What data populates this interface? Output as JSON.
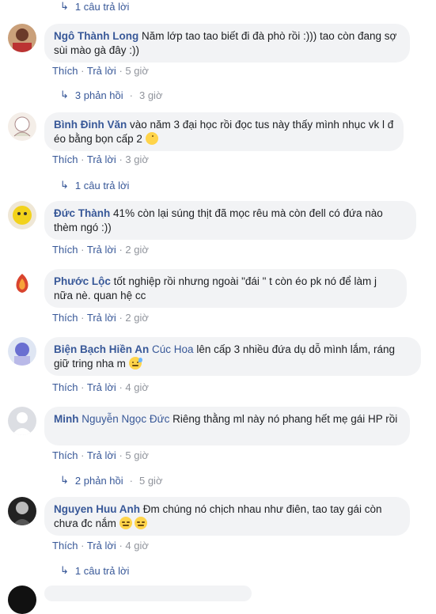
{
  "action_like": "Thích",
  "action_reply": "Trả lời",
  "sep": "·",
  "top_reply": {
    "text": "1 câu trả lời"
  },
  "comments": [
    {
      "name": "Ngô Thành Long",
      "tag": "",
      "text": "Năm lớp tao tao biết đi đà phò rồi :))) tao còn đang sợ sùi mào gà đây :))",
      "time": "5 giờ",
      "replies": "3 phản hồi",
      "replies_time": "3 giờ"
    },
    {
      "name": "Bình Đinh Văn",
      "tag": "",
      "text": "vào năm 3 đại học rồi đọc tus này thấy mình nhục vk l đ éo bằng bọn cấp 2",
      "emoji": "pacman",
      "time": "3 giờ",
      "replies": "1 câu trả lời"
    },
    {
      "name": "Đức Thành",
      "tag": "",
      "text": "41% còn lại súng thịt đã mọc rêu mà còn đell có đứa nào thèm ngó :))",
      "time": "2 giờ"
    },
    {
      "name": "Phước Lộc",
      "tag": "",
      "text": "tốt nghiệp rồi nhưng ngoài \"đái \" t còn éo pk nó để làm j nữa nè. quan hệ cc",
      "time": "2 giờ"
    },
    {
      "name": "Biện Bạch Hiền An",
      "tag": "Cúc Hoa",
      "text": "lên cấp 3 nhiều đứa dụ dỗ mình lắm, ráng giữ tring nha m",
      "emoji": "sweat",
      "time": "4 giờ"
    },
    {
      "name": "Minh",
      "tag": "Nguyễn Ngọc Đức",
      "text": "Riêng thằng ml này nó phang hết mẹ gái HP rồi",
      "time": "5 giờ",
      "replies": "2 phản hồi",
      "replies_time": "5 giờ"
    },
    {
      "name": "Nguyen Huu Anh",
      "tag": "",
      "text": "Đm chúng nó chịch nhau như điên, tao tay gái còn chưa đc nắm",
      "emoji": "expressionless",
      "time": "4 giờ",
      "replies": "1 câu trả lời"
    }
  ]
}
